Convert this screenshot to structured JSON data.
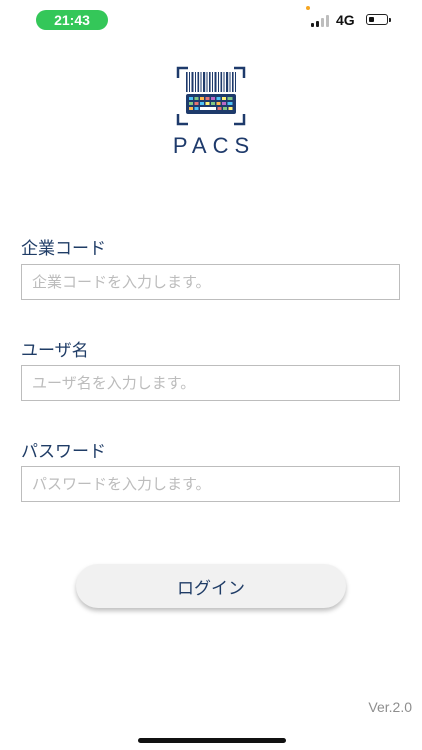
{
  "status_bar": {
    "time": "21:43",
    "network": "4G",
    "signal_bars_filled": 2,
    "battery_level_fraction": 0.3
  },
  "logo": {
    "text": "PACS",
    "icon": "barcode-scanner-icon"
  },
  "form": {
    "company_code": {
      "label": "企業コード",
      "placeholder": "企業コードを入力します。",
      "value": ""
    },
    "username": {
      "label": "ユーザ名",
      "placeholder": "ユーザ名を入力します。",
      "value": ""
    },
    "password": {
      "label": "パスワード",
      "placeholder": "パスワードを入力します。",
      "value": ""
    }
  },
  "login_button": {
    "label": "ログイン"
  },
  "version": "Ver.2.0",
  "colors": {
    "brand_navy": "#1e3a6b",
    "time_pill_green": "#34c759",
    "input_border": "#bdbdbd",
    "button_bg": "#f1f1f1"
  }
}
